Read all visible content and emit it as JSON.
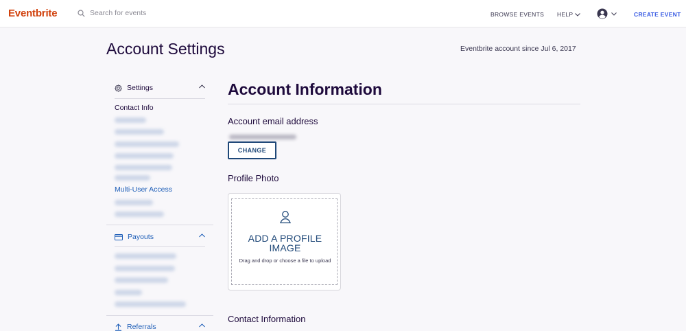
{
  "header": {
    "logo": "Eventbrite",
    "search_placeholder": "Search for events",
    "browse_events": "BROWSE EVENTS",
    "help": "HELP",
    "create_event": "CREATE EVENT"
  },
  "page": {
    "title": "Account Settings",
    "member_since": "Eventbrite account since Jul 6, 2017"
  },
  "sidebar": {
    "settings": {
      "label": "Settings",
      "contact_info": "Contact Info",
      "multi_user_access": "Multi-User Access"
    },
    "payouts": {
      "label": "Payouts"
    },
    "referrals": {
      "label": "Referrals"
    }
  },
  "main": {
    "section_title": "Account Information",
    "email_label": "Account email address",
    "change_button": "CHANGE",
    "profile_photo_label": "Profile Photo",
    "add_image_line1": "ADD A PROFILE",
    "add_image_line2": "IMAGE",
    "drag_hint": "Drag and drop or choose a file to upload",
    "contact_information_label": "Contact Information"
  },
  "colors": {
    "brand": "#d1410c",
    "link_blue": "#1f5fb8",
    "button_navy": "#1f4878",
    "create_event": "#3659e3"
  }
}
